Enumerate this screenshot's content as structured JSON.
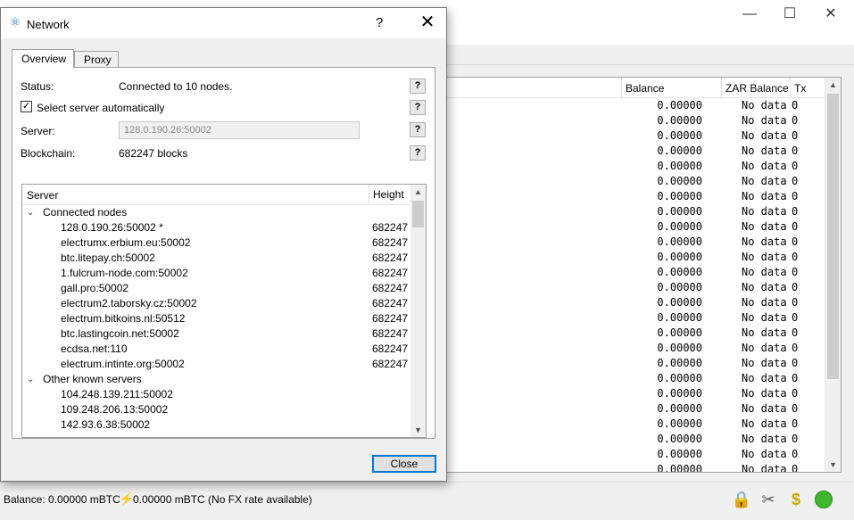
{
  "main": {
    "header": {
      "balance": "Balance",
      "zar_balance": "ZAR Balance",
      "tx": "Tx"
    },
    "rows": [
      {
        "balance": "0.00000",
        "zar": "No data",
        "tx": "0"
      },
      {
        "balance": "0.00000",
        "zar": "No data",
        "tx": "0"
      },
      {
        "balance": "0.00000",
        "zar": "No data",
        "tx": "0"
      },
      {
        "balance": "0.00000",
        "zar": "No data",
        "tx": "0"
      },
      {
        "balance": "0.00000",
        "zar": "No data",
        "tx": "0"
      },
      {
        "balance": "0.00000",
        "zar": "No data",
        "tx": "0"
      },
      {
        "balance": "0.00000",
        "zar": "No data",
        "tx": "0"
      },
      {
        "balance": "0.00000",
        "zar": "No data",
        "tx": "0"
      },
      {
        "balance": "0.00000",
        "zar": "No data",
        "tx": "0"
      },
      {
        "balance": "0.00000",
        "zar": "No data",
        "tx": "0"
      },
      {
        "balance": "0.00000",
        "zar": "No data",
        "tx": "0"
      },
      {
        "balance": "0.00000",
        "zar": "No data",
        "tx": "0"
      },
      {
        "balance": "0.00000",
        "zar": "No data",
        "tx": "0"
      },
      {
        "balance": "0.00000",
        "zar": "No data",
        "tx": "0"
      },
      {
        "balance": "0.00000",
        "zar": "No data",
        "tx": "0"
      },
      {
        "balance": "0.00000",
        "zar": "No data",
        "tx": "0"
      },
      {
        "balance": "0.00000",
        "zar": "No data",
        "tx": "0"
      },
      {
        "balance": "0.00000",
        "zar": "No data",
        "tx": "0"
      },
      {
        "balance": "0.00000",
        "zar": "No data",
        "tx": "0"
      },
      {
        "balance": "0.00000",
        "zar": "No data",
        "tx": "0"
      },
      {
        "balance": "0.00000",
        "zar": "No data",
        "tx": "0"
      },
      {
        "balance": "0.00000",
        "zar": "No data",
        "tx": "0"
      },
      {
        "balance": "0.00000",
        "zar": "No data",
        "tx": "0"
      },
      {
        "balance": "0.00000",
        "zar": "No data",
        "tx": "0"
      },
      {
        "balance": "0.00000",
        "zar": "No data",
        "tx": "0"
      }
    ]
  },
  "statusbar": {
    "balance": "Balance: 0.00000 mBTC",
    "fx": "0.00000 mBTC  (No FX rate available)",
    "network_status_color": "#3fb62d"
  },
  "dialog": {
    "title": "Network",
    "help_glyph": "?",
    "close_glyph": "✕",
    "tabs": {
      "overview": "Overview",
      "proxy": "Proxy"
    },
    "status_label": "Status:",
    "status_value": "Connected to 10 nodes.",
    "auto_label": "Select server automatically",
    "auto_checked": "✓",
    "server_label": "Server:",
    "server_value": "128.0.190.26:50002",
    "blockchain_label": "Blockchain:",
    "blockchain_value": "682247 blocks",
    "q": "?",
    "tree": {
      "col_server": "Server",
      "col_height": "Height",
      "connected_label": "Connected nodes",
      "connected": [
        {
          "host": "128.0.190.26:50002 *",
          "height": "682247"
        },
        {
          "host": "electrumx.erbium.eu:50002",
          "height": "682247"
        },
        {
          "host": "btc.litepay.ch:50002",
          "height": "682247"
        },
        {
          "host": "1.fulcrum-node.com:50002",
          "height": "682247"
        },
        {
          "host": "gall.pro:50002",
          "height": "682247"
        },
        {
          "host": "electrum2.taborsky.cz:50002",
          "height": "682247"
        },
        {
          "host": "electrum.bitkoins.nl:50512",
          "height": "682247"
        },
        {
          "host": "btc.lastingcoin.net:50002",
          "height": "682247"
        },
        {
          "host": "ecdsa.net:110",
          "height": "682247"
        },
        {
          "host": "electrum.intinte.org:50002",
          "height": "682247"
        }
      ],
      "other_label": "Other known servers",
      "other": [
        {
          "host": "104.248.139.211:50002"
        },
        {
          "host": "109.248.206.13:50002"
        },
        {
          "host": "142.93.6.38:50002"
        }
      ]
    },
    "close_button": "Close"
  }
}
